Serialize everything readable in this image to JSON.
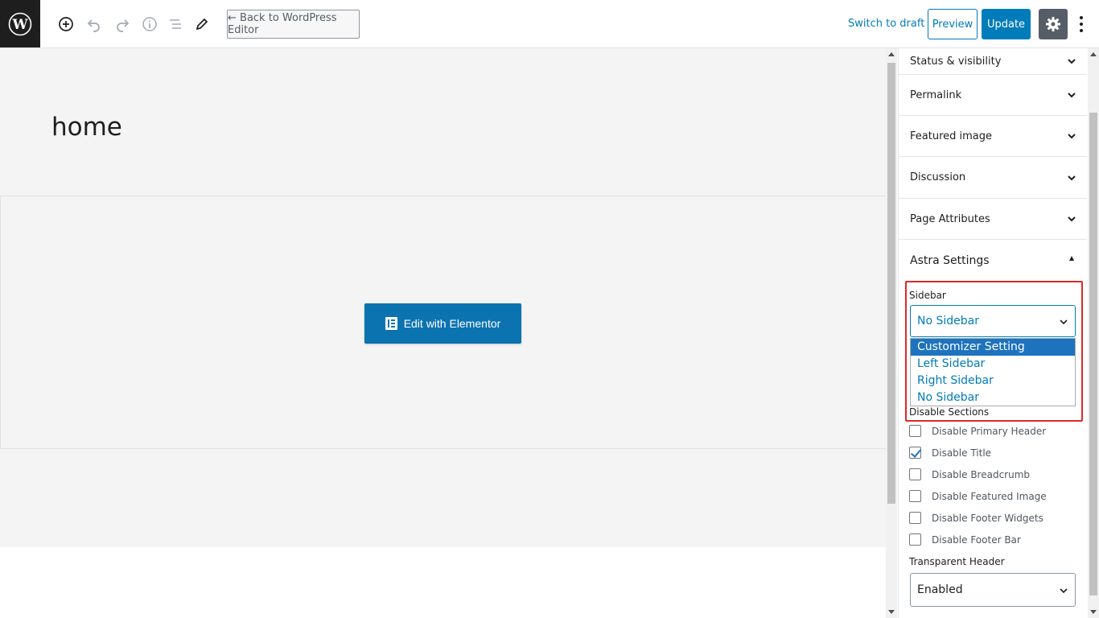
{
  "toolbar": {
    "back_label": "← Back to WordPress Editor",
    "switch_draft": "Switch to draft",
    "preview": "Preview",
    "update": "Update",
    "icons": [
      "wordpress-icon",
      "add-block-icon",
      "undo-icon",
      "redo-icon",
      "info-icon",
      "outline-icon",
      "edit-icon",
      "gear-icon",
      "more-vertical-icon"
    ]
  },
  "editor": {
    "title": "home",
    "elementor_button": "Edit with Elementor"
  },
  "sidebar": {
    "panels": [
      {
        "label": "Status & visibility"
      },
      {
        "label": "Permalink"
      },
      {
        "label": "Featured image"
      },
      {
        "label": "Discussion"
      },
      {
        "label": "Page Attributes"
      }
    ],
    "astra": {
      "title": "Astra Settings",
      "sidebar_label": "Sidebar",
      "sidebar_value": "No Sidebar",
      "sidebar_options": [
        "Customizer Setting",
        "Left Sidebar",
        "Right Sidebar",
        "No Sidebar"
      ],
      "sidebar_highlighted": "Customizer Setting",
      "disable_sections_label": "Disable Sections",
      "checkboxes": [
        {
          "label": "Disable Primary Header",
          "checked": false
        },
        {
          "label": "Disable Title",
          "checked": true
        },
        {
          "label": "Disable Breadcrumb",
          "checked": false
        },
        {
          "label": "Disable Featured Image",
          "checked": false
        },
        {
          "label": "Disable Footer Widgets",
          "checked": false
        },
        {
          "label": "Disable Footer Bar",
          "checked": false
        }
      ],
      "transparent_header_label": "Transparent Header",
      "transparent_header_value": "Enabled"
    }
  },
  "colors": {
    "accent": "#007cba",
    "highlight_border": "#e02828",
    "elementor": "#0c73b1"
  }
}
